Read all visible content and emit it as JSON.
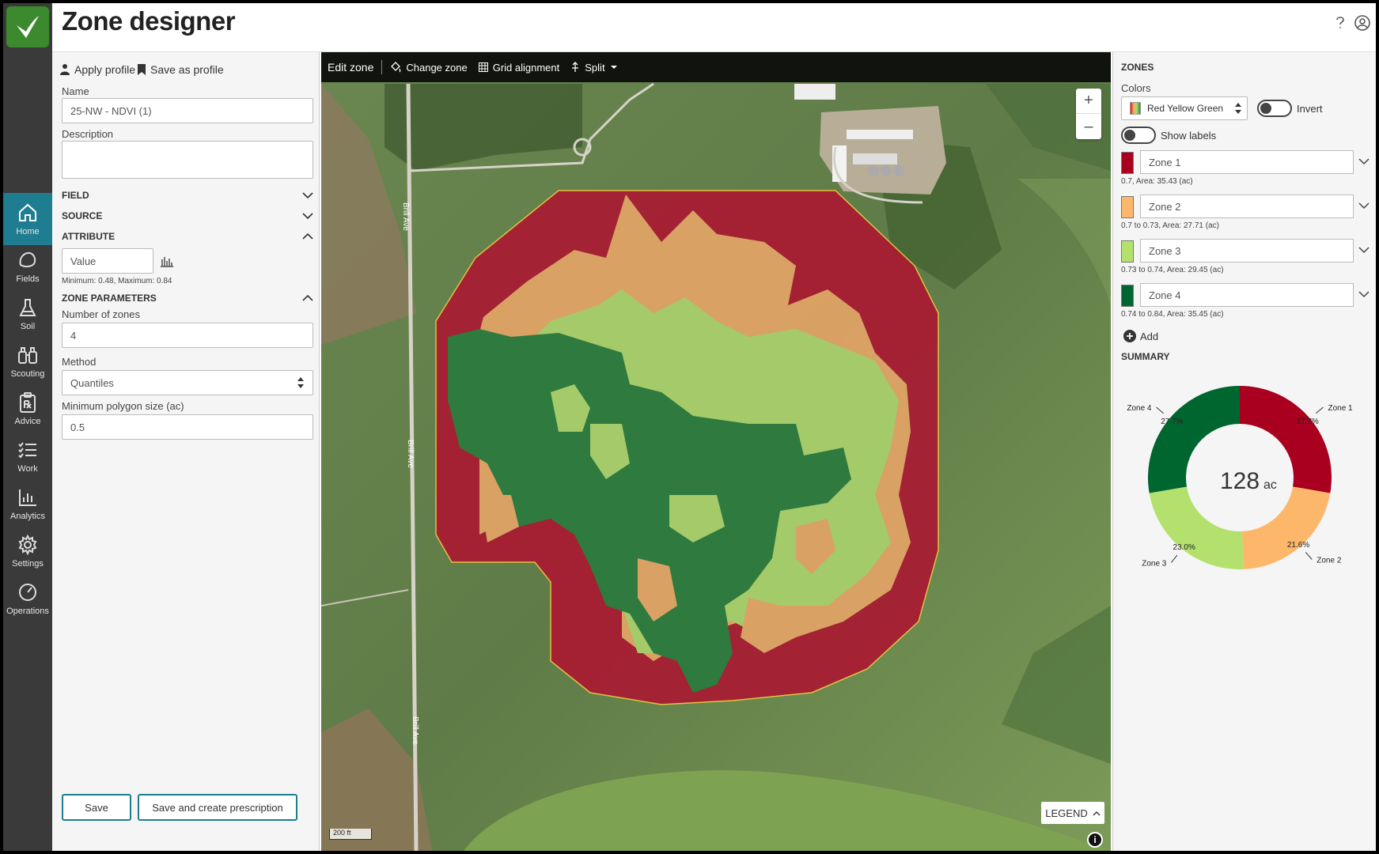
{
  "app": {
    "title": "Zone designer"
  },
  "nav": {
    "items": [
      {
        "label": "Home",
        "icon": "home-icon"
      },
      {
        "label": "Fields",
        "icon": "field-icon"
      },
      {
        "label": "Soil",
        "icon": "flask-icon"
      },
      {
        "label": "Scouting",
        "icon": "binoculars-icon"
      },
      {
        "label": "Advice",
        "icon": "clipboard-rx-icon"
      },
      {
        "label": "Work",
        "icon": "checklist-icon"
      },
      {
        "label": "Analytics",
        "icon": "bar-chart-icon"
      },
      {
        "label": "Settings",
        "icon": "gear-icon"
      },
      {
        "label": "Operations",
        "icon": "gauge-icon"
      }
    ]
  },
  "left": {
    "apply_profile": "Apply profile",
    "save_as_profile": "Save as profile",
    "name_label": "Name",
    "name_value": "25-NW - NDVI (1)",
    "description_label": "Description",
    "field_section": "FIELD",
    "source_section": "SOURCE",
    "attribute_section": "ATTRIBUTE",
    "attribute_value": "Value",
    "attribute_range": "Minimum: 0.48, Maximum: 0.84",
    "zone_params_section": "ZONE PARAMETERS",
    "num_zones_label": "Number of zones",
    "num_zones_value": "4",
    "method_label": "Method",
    "method_value": "Quantiles",
    "min_poly_label": "Minimum polygon size (ac)",
    "min_poly_value": "0.5",
    "save_button": "Save",
    "save_create_button": "Save and create prescription"
  },
  "map": {
    "edit_zone": "Edit zone",
    "change_zone": "Change zone",
    "grid_alignment": "Grid alignment",
    "split": "Split",
    "legend": "LEGEND",
    "scale": "200 ft",
    "road_label": "Brill Ave",
    "colors": {
      "zone1": "#a71d32",
      "zone2": "#e0a366",
      "zone3": "#a8cf6c",
      "zone4": "#2d7a3e"
    }
  },
  "right": {
    "zones_head": "ZONES",
    "colors_label": "Colors",
    "palette": "Red Yellow Green",
    "invert_label": "Invert",
    "show_labels": "Show labels",
    "add_label": "Add",
    "summary_head": "SUMMARY",
    "total_value": "128",
    "total_unit": "ac",
    "zones": [
      {
        "name": "Zone 1",
        "note": "0.7, Area: 35.43 (ac)",
        "color": "#a8001e",
        "pct": "27.7%"
      },
      {
        "name": "Zone 2",
        "note": "0.7 to 0.73, Area: 27.71 (ac)",
        "color": "#fdb76a",
        "pct": "21.6%"
      },
      {
        "name": "Zone 3",
        "note": "0.73 to 0.74, Area: 29.45 (ac)",
        "color": "#b4e06e",
        "pct": "23.0%"
      },
      {
        "name": "Zone 4",
        "note": "0.74 to 0.84, Area: 35.45 (ac)",
        "color": "#006630",
        "pct": "27.7%"
      }
    ]
  }
}
